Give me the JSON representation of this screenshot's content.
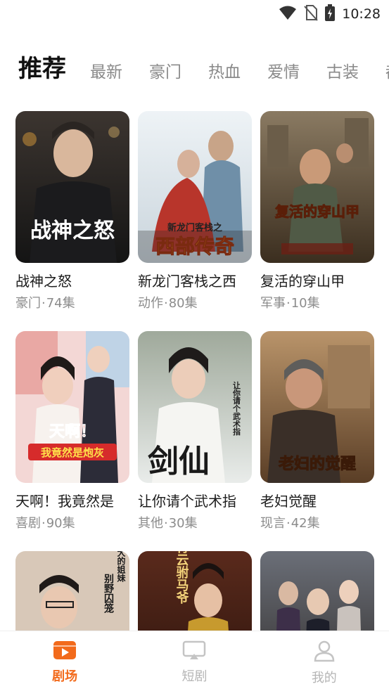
{
  "status_bar": {
    "time": "10:28",
    "icons": [
      "wifi-icon",
      "no-sim-icon",
      "battery-charging-icon"
    ]
  },
  "tabs": [
    {
      "label": "推荐",
      "active": true
    },
    {
      "label": "最新",
      "active": false
    },
    {
      "label": "豪门",
      "active": false
    },
    {
      "label": "热血",
      "active": false
    },
    {
      "label": "爱情",
      "active": false
    },
    {
      "label": "古装",
      "active": false
    },
    {
      "label": "都",
      "active": false
    }
  ],
  "dramas": [
    {
      "title": "战神之怒",
      "genre": "豪门",
      "episodes": "74集",
      "cover_text": "战神之怒"
    },
    {
      "title": "新龙门客栈之西",
      "genre": "动作",
      "episodes": "80集",
      "cover_text": "西部传奇",
      "cover_subtext": "新龙门客栈之"
    },
    {
      "title": "复活的穿山甲",
      "genre": "军事",
      "episodes": "10集",
      "cover_text": "复活的穿山甲"
    },
    {
      "title": "天啊！我竟然是",
      "genre": "喜剧",
      "episodes": "90集",
      "cover_text": "天啊！",
      "cover_subtext": "我竟然是炮灰"
    },
    {
      "title": "让你请个武术指",
      "genre": "其他",
      "episodes": "30集",
      "cover_text": "剑仙",
      "cover_subtext": "让你请个武术指"
    },
    {
      "title": "老妇觉醒",
      "genre": "现言",
      "episodes": "42集",
      "cover_text": "老妇的觉醒"
    },
    {
      "title": "",
      "genre": "",
      "episodes": "",
      "cover_text": "别野囚笼",
      "cover_subtext": "大的姐妹"
    },
    {
      "title": "",
      "genre": "",
      "episodes": "",
      "cover_text": "青云驸马爷"
    },
    {
      "title": "",
      "genre": "",
      "episodes": "",
      "cover_text": ""
    }
  ],
  "meta_separator": "·",
  "bottom_nav": [
    {
      "label": "剧场",
      "icon": "theater-play-icon",
      "active": true
    },
    {
      "label": "短剧",
      "icon": "screen-cast-icon",
      "active": false
    },
    {
      "label": "我的",
      "icon": "profile-icon",
      "active": false
    }
  ],
  "colors": {
    "accent": "#f26a1b",
    "inactive": "#b5b5b5",
    "tab_inactive": "#8a8a8a",
    "meta": "#8c8c8c"
  }
}
